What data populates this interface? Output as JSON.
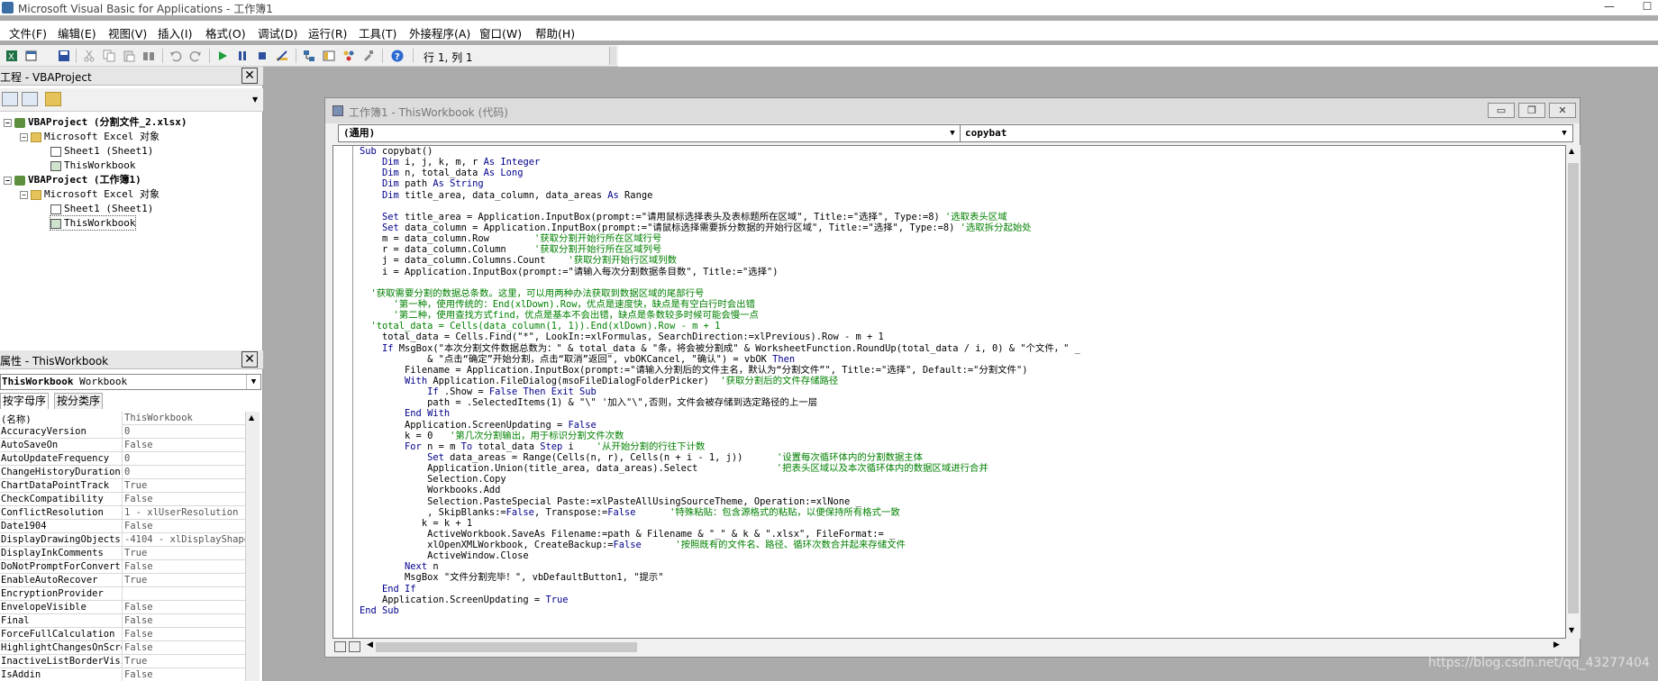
{
  "app": {
    "title": "Microsoft Visual Basic for Applications - 工作簿1",
    "minimize": "—",
    "maximize": "☐"
  },
  "menu": [
    "文件(F)",
    "编辑(E)",
    "视图(V)",
    "插入(I)",
    "格式(O)",
    "调试(D)",
    "运行(R)",
    "工具(T)",
    "外接程序(A)",
    "窗口(W)",
    "帮助(H)"
  ],
  "toolbar": {
    "position": "行 1, 列 1",
    "icons": [
      "excel-icon",
      "insert-userform-icon",
      "save-icon",
      "cut-icon",
      "copy-icon",
      "paste-icon",
      "find-icon",
      "undo-icon",
      "redo-icon",
      "run-icon",
      "break-icon",
      "reset-icon",
      "design-mode-icon",
      "project-explorer-icon",
      "properties-icon",
      "object-browser-icon",
      "toolbox-icon",
      "help-icon"
    ]
  },
  "project_panel": {
    "title": "工程 - VBAProject",
    "close": "✕",
    "tree": [
      {
        "label": "VBAProject (分割文件_2.xlsx)",
        "level": 0,
        "icon": "vba-project-icon",
        "bold": true,
        "expander": "−"
      },
      {
        "label": "Microsoft Excel 对象",
        "level": 1,
        "icon": "folder-icon",
        "bold": false,
        "expander": "−"
      },
      {
        "label": "Sheet1 (Sheet1)",
        "level": 2,
        "icon": "worksheet-icon",
        "bold": false,
        "expander": ""
      },
      {
        "label": "ThisWorkbook",
        "level": 2,
        "icon": "workbook-icon",
        "bold": false,
        "expander": ""
      },
      {
        "label": "VBAProject (工作簿1)",
        "level": 0,
        "icon": "vba-project-icon",
        "bold": true,
        "expander": "−"
      },
      {
        "label": "Microsoft Excel 对象",
        "level": 1,
        "icon": "folder-icon",
        "bold": false,
        "expander": "−"
      },
      {
        "label": "Sheet1 (Sheet1)",
        "level": 2,
        "icon": "worksheet-icon",
        "bold": false,
        "expander": ""
      },
      {
        "label": "ThisWorkbook",
        "level": 2,
        "icon": "workbook-icon",
        "bold": false,
        "expander": ""
      }
    ]
  },
  "props_panel": {
    "title": "属性 - ThisWorkbook",
    "close": "✕",
    "object_name": "ThisWorkbook",
    "object_type": "Workbook",
    "tabs": [
      "按字母序",
      "按分类序"
    ],
    "rows": [
      {
        "name": "(名称)",
        "value": "ThisWorkbook"
      },
      {
        "name": "AccuracyVersion",
        "value": "0"
      },
      {
        "name": "AutoSaveOn",
        "value": "False"
      },
      {
        "name": "AutoUpdateFrequency",
        "value": "0"
      },
      {
        "name": "ChangeHistoryDuration",
        "value": "0"
      },
      {
        "name": "ChartDataPointTrack",
        "value": "True"
      },
      {
        "name": "CheckCompatibility",
        "value": "False"
      },
      {
        "name": "ConflictResolution",
        "value": "1 - xlUserResolution"
      },
      {
        "name": "Date1904",
        "value": "False"
      },
      {
        "name": "DisplayDrawingObjects",
        "value": "-4104 - xlDisplayShapes"
      },
      {
        "name": "DisplayInkComments",
        "value": "True"
      },
      {
        "name": "DoNotPromptForConvert",
        "value": "False"
      },
      {
        "name": "EnableAutoRecover",
        "value": "True"
      },
      {
        "name": "EncryptionProvider",
        "value": ""
      },
      {
        "name": "EnvelopeVisible",
        "value": "False"
      },
      {
        "name": "Final",
        "value": "False"
      },
      {
        "name": "ForceFullCalculation",
        "value": "False"
      },
      {
        "name": "HighlightChangesOnScreen",
        "value": "False"
      },
      {
        "name": "InactiveListBorderVisible",
        "value": "True"
      },
      {
        "name": "IsAddin",
        "value": "False"
      }
    ]
  },
  "code_window": {
    "title": "工作簿1 - ThisWorkbook (代码)",
    "object_combo": "(通用)",
    "proc_combo": "copybat",
    "buttons": [
      "▭",
      "❐",
      "✕"
    ],
    "lines": [
      [
        [
          "kw",
          "Sub"
        ],
        [
          "t",
          " copybat()"
        ]
      ],
      [
        [
          "t",
          "    "
        ],
        [
          "kw",
          "Dim"
        ],
        [
          "t",
          " i, j, k, m, r "
        ],
        [
          "kw",
          "As Integer"
        ]
      ],
      [
        [
          "t",
          "    "
        ],
        [
          "kw",
          "Dim"
        ],
        [
          "t",
          " n, total_data "
        ],
        [
          "kw",
          "As Long"
        ]
      ],
      [
        [
          "t",
          "    "
        ],
        [
          "kw",
          "Dim"
        ],
        [
          "t",
          " path "
        ],
        [
          "kw",
          "As String"
        ]
      ],
      [
        [
          "t",
          "    "
        ],
        [
          "kw",
          "Dim"
        ],
        [
          "t",
          " title_area, data_column, data_areas "
        ],
        [
          "kw",
          "As"
        ],
        [
          "t",
          " Range"
        ]
      ],
      [
        [
          "t",
          ""
        ]
      ],
      [
        [
          "t",
          "    "
        ],
        [
          "kw",
          "Set"
        ],
        [
          "t",
          " title_area = Application.InputBox(prompt:=\"请用鼠标选择表头及表标题所在区域\", Title:=\"选择\", Type:=8) "
        ],
        [
          "cm",
          "'选取表头区域"
        ]
      ],
      [
        [
          "t",
          "    "
        ],
        [
          "kw",
          "Set"
        ],
        [
          "t",
          " data_column = Application.InputBox(prompt:=\"请鼠标选择需要拆分数据的开始行区域\", Title:=\"选择\", Type:=8) "
        ],
        [
          "cm",
          "'选取拆分起始处"
        ]
      ],
      [
        [
          "t",
          "    m = data_column.Row        "
        ],
        [
          "cm",
          "'获取分割开始行所在区域行号"
        ]
      ],
      [
        [
          "t",
          "    r = data_column.Column     "
        ],
        [
          "cm",
          "'获取分割开始行所在区域列号"
        ]
      ],
      [
        [
          "t",
          "    j = data_column.Columns.Count    "
        ],
        [
          "cm",
          "'获取分割开始行区域列数"
        ]
      ],
      [
        [
          "t",
          "    i = Application.InputBox(prompt:=\"请输入每次分割数据条目数\", Title:=\"选择\")"
        ]
      ],
      [
        [
          "t",
          ""
        ]
      ],
      [
        [
          "t",
          "  "
        ],
        [
          "cm",
          "'获取需要分割的数据总条数。这里，可以用两种办法获取到数据区域的尾部行号"
        ]
      ],
      [
        [
          "t",
          "      "
        ],
        [
          "cm",
          "'第一种，使用传统的：End(xlDown).Row，优点是速度快，缺点是有空白行时会出错"
        ]
      ],
      [
        [
          "t",
          "      "
        ],
        [
          "cm",
          "'第二种，使用查找方式find，优点是基本不会出错，缺点是条数较多时候可能会慢一点"
        ]
      ],
      [
        [
          "t",
          "  "
        ],
        [
          "cm",
          "'total_data = Cells(data_column(1, 1)).End(xlDown).Row - m + 1"
        ]
      ],
      [
        [
          "t",
          "    total_data = Cells.Find(\"*\", LookIn:=xlFormulas, SearchDirection:=xlPrevious).Row - m + 1"
        ]
      ],
      [
        [
          "t",
          "    "
        ],
        [
          "kw",
          "If"
        ],
        [
          "t",
          " MsgBox(\"本次分割文件数据总数为：\" & total_data & \"条，将会被分割成\" & WorksheetFunction.RoundUp(total_data / i, 0) & \"个文件，\" _"
        ]
      ],
      [
        [
          "t",
          "            & \"点击“确定”开始分割，点击“取消”返回\", vbOKCancel, \"确认\") = vbOK "
        ],
        [
          "kw",
          "Then"
        ]
      ],
      [
        [
          "t",
          "        Filename = Application.InputBox(prompt:=\"请输入分割后的文件主名，默认为“分割文件”\", Title:=\"选择\", Default:=\"分割文件\")"
        ]
      ],
      [
        [
          "t",
          "        "
        ],
        [
          "kw",
          "With"
        ],
        [
          "t",
          " Application.FileDialog(msoFileDialogFolderPicker)  "
        ],
        [
          "cm",
          "'获取分割后的文件存储路径"
        ]
      ],
      [
        [
          "t",
          "            "
        ],
        [
          "kw",
          "If"
        ],
        [
          "t",
          " .Show = "
        ],
        [
          "kw",
          "False Then Exit Sub"
        ]
      ],
      [
        [
          "t",
          "            path = .SelectedItems(1) & \"\\\" '加入\"\\\",否则，文件会被存储到选定路径的上一层"
        ]
      ],
      [
        [
          "t",
          "        "
        ],
        [
          "kw",
          "End With"
        ]
      ],
      [
        [
          "t",
          "        Application.ScreenUpdating = "
        ],
        [
          "kw",
          "False"
        ]
      ],
      [
        [
          "t",
          "        k = 0   "
        ],
        [
          "cm",
          "'第几次分割输出，用于标识分割文件次数"
        ]
      ],
      [
        [
          "t",
          "        "
        ],
        [
          "kw",
          "For"
        ],
        [
          "t",
          " n = m "
        ],
        [
          "kw",
          "To"
        ],
        [
          "t",
          " total_data "
        ],
        [
          "kw",
          "Step"
        ],
        [
          "t",
          " i    "
        ],
        [
          "cm",
          "'从开始分割的行往下计数"
        ]
      ],
      [
        [
          "t",
          "            "
        ],
        [
          "kw",
          "Set"
        ],
        [
          "t",
          " data_areas = Range(Cells(n, r), Cells(n + i - 1, j))      "
        ],
        [
          "cm",
          "'设置每次循环体内的分割数据主体"
        ]
      ],
      [
        [
          "t",
          "            Application.Union(title_area, data_areas).Select              "
        ],
        [
          "cm",
          "'把表头区域以及本次循环体内的数据区域进行合并"
        ]
      ],
      [
        [
          "t",
          "            Selection.Copy"
        ]
      ],
      [
        [
          "t",
          "            Workbooks.Add"
        ]
      ],
      [
        [
          "t",
          "            Selection.PasteSpecial Paste:=xlPasteAllUsingSourceTheme, Operation:=xlNone _"
        ]
      ],
      [
        [
          "t",
          "            , SkipBlanks:="
        ],
        [
          "kw",
          "False"
        ],
        [
          "t",
          ", Transpose:="
        ],
        [
          "kw",
          "False"
        ],
        [
          "t",
          "      "
        ],
        [
          "cm",
          "'特殊粘贴：包含源格式的粘贴，以便保持所有格式一致"
        ]
      ],
      [
        [
          "t",
          "           k = k + 1"
        ]
      ],
      [
        [
          "t",
          "            ActiveWorkbook.SaveAs Filename:=path & Filename & \"_\" & k & \".xlsx\", FileFormat:= _"
        ]
      ],
      [
        [
          "t",
          "            xlOpenXMLWorkbook, CreateBackup:="
        ],
        [
          "kw",
          "False"
        ],
        [
          "t",
          "      "
        ],
        [
          "cm",
          "'按照既有的文件名、路径、循环次数合并起来存储文件"
        ]
      ],
      [
        [
          "t",
          "            ActiveWindow.Close"
        ]
      ],
      [
        [
          "t",
          "        "
        ],
        [
          "kw",
          "Next"
        ],
        [
          "t",
          " n"
        ]
      ],
      [
        [
          "t",
          "        MsgBox \"文件分割完毕！\", vbDefaultButton1, \"提示\""
        ]
      ],
      [
        [
          "t",
          "    "
        ],
        [
          "kw",
          "End If"
        ]
      ],
      [
        [
          "t",
          "    Application.ScreenUpdating = "
        ],
        [
          "kw",
          "True"
        ]
      ],
      [
        [
          "kw",
          "End Sub"
        ]
      ]
    ]
  },
  "watermark": "https://blog.csdn.net/qq_43277404"
}
